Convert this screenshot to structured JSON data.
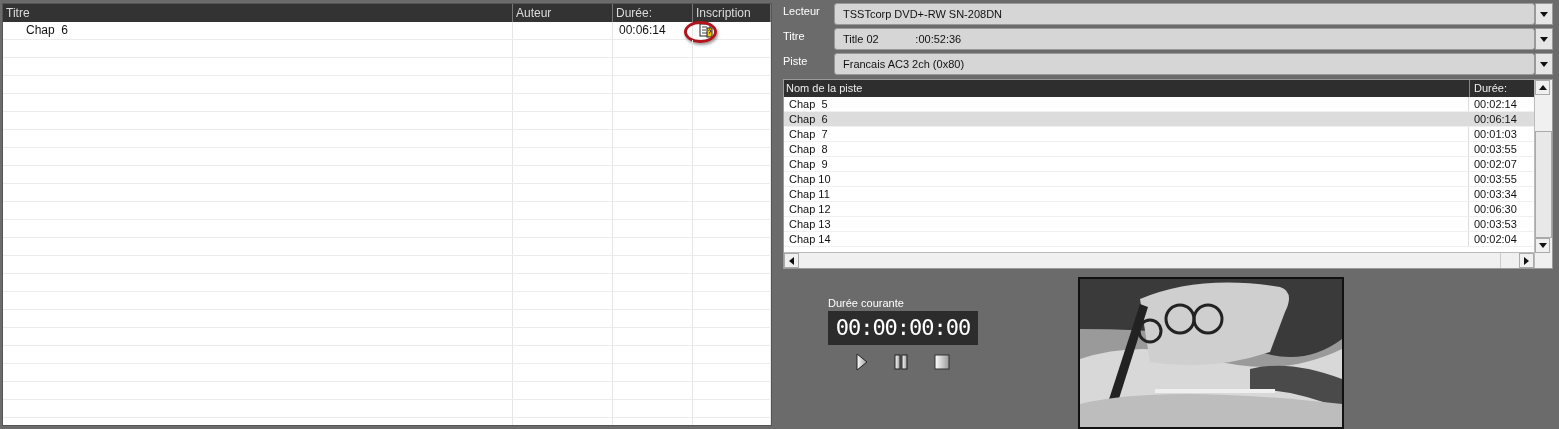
{
  "playlist": {
    "columns": [
      "Titre",
      "Auteur",
      "Durée:",
      "Inscription"
    ],
    "rows": [
      {
        "title": "Chap  6",
        "duration": "00:06:14",
        "annotated": true
      }
    ]
  },
  "fields": [
    {
      "label": "Lecteur",
      "value": "TSSTcorp DVD+-RW SN-208DN"
    },
    {
      "label": "Titre",
      "value": "Title 02            :00:52:36"
    },
    {
      "label": "Piste",
      "value": "Francais AC3 2ch (0x80)"
    }
  ],
  "tracks": {
    "columns": [
      "Nom de la piste",
      "Durée:"
    ],
    "rows": [
      {
        "name": "Chap  5",
        "duration": "00:02:14",
        "selected": false
      },
      {
        "name": "Chap  6",
        "duration": "00:06:14",
        "selected": true
      },
      {
        "name": "Chap  7",
        "duration": "00:01:03",
        "selected": false
      },
      {
        "name": "Chap  8",
        "duration": "00:03:55",
        "selected": false
      },
      {
        "name": "Chap  9",
        "duration": "00:02:07",
        "selected": false
      },
      {
        "name": "Chap 10",
        "duration": "00:03:55",
        "selected": false
      },
      {
        "name": "Chap 11",
        "duration": "00:03:34",
        "selected": false
      },
      {
        "name": "Chap 12",
        "duration": "00:06:30",
        "selected": false
      },
      {
        "name": "Chap 13",
        "duration": "00:03:53",
        "selected": false
      },
      {
        "name": "Chap 14",
        "duration": "00:02:04",
        "selected": false
      }
    ]
  },
  "player": {
    "label": "Durée courante",
    "time": "00:00:00:00"
  }
}
